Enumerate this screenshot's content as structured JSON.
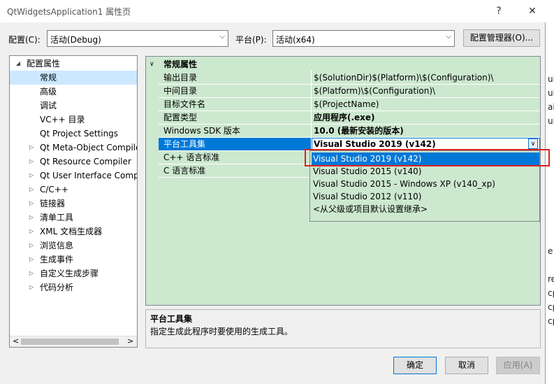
{
  "window": {
    "title": "QtWidgetsApplication1 属性页",
    "help_button": "?",
    "close_button": "✕"
  },
  "config": {
    "label": "配置(C):",
    "value": "活动(Debug)",
    "platform_label": "平台(P):",
    "platform_value": "活动(x64)",
    "manager_button": "配置管理器(O)..."
  },
  "tree": {
    "root": "配置属性",
    "items": [
      {
        "label": "常规",
        "expandable": false,
        "selected": true
      },
      {
        "label": "高级",
        "expandable": false
      },
      {
        "label": "调试",
        "expandable": false
      },
      {
        "label": "VC++ 目录",
        "expandable": false
      },
      {
        "label": "Qt Project Settings",
        "expandable": false
      },
      {
        "label": "Qt Meta-Object Compile",
        "expandable": true
      },
      {
        "label": "Qt Resource Compiler",
        "expandable": true
      },
      {
        "label": "Qt User Interface Comp",
        "expandable": true
      },
      {
        "label": "C/C++",
        "expandable": true
      },
      {
        "label": "链接器",
        "expandable": true
      },
      {
        "label": "清单工具",
        "expandable": true
      },
      {
        "label": "XML 文档生成器",
        "expandable": true
      },
      {
        "label": "浏览信息",
        "expandable": true
      },
      {
        "label": "生成事件",
        "expandable": true
      },
      {
        "label": "自定义生成步骤",
        "expandable": true
      },
      {
        "label": "代码分析",
        "expandable": true
      }
    ],
    "scroll_left": "<",
    "scroll_right": ">"
  },
  "grid": {
    "section": "常规属性",
    "rows": [
      {
        "name": "输出目录",
        "value": "$(SolutionDir)$(Platform)\\$(Configuration)\\",
        "bold": false
      },
      {
        "name": "中间目录",
        "value": "$(Platform)\\$(Configuration)\\",
        "bold": false
      },
      {
        "name": "目标文件名",
        "value": "$(ProjectName)",
        "bold": false
      },
      {
        "name": "配置类型",
        "value": "应用程序(.exe)",
        "bold": true
      },
      {
        "name": "Windows SDK 版本",
        "value": "10.0 (最新安装的版本)",
        "bold": true
      },
      {
        "name": "平台工具集",
        "value": "Visual Studio 2019 (v142)",
        "bold": true,
        "selected": true
      },
      {
        "name": "C++ 语言标准",
        "value": "",
        "bold": false
      },
      {
        "name": "C 语言标准",
        "value": "",
        "bold": false
      }
    ]
  },
  "dropdown": {
    "options": [
      {
        "label": "Visual Studio 2019 (v142)",
        "selected": true
      },
      {
        "label": "Visual Studio 2015 (v140)"
      },
      {
        "label": "Visual Studio 2015 - Windows XP (v140_xp)"
      },
      {
        "label": "Visual Studio 2012 (v110)"
      },
      {
        "label": "<从父级或项目默认设置继承>"
      }
    ]
  },
  "description": {
    "title": "平台工具集",
    "text": "指定生成此程序时要使用的生成工具。"
  },
  "buttons": {
    "ok": "确定",
    "cancel": "取消",
    "apply": "应用(A)"
  },
  "background_fragments": [
    "ui",
    "ui",
    "ai",
    "ui",
    "e",
    "re",
    "cp",
    "cp",
    "cp"
  ],
  "colors": {
    "grid_bg": "#cce8cf",
    "selection_blue": "#0078d7",
    "tree_selection": "#cce8ff",
    "highlight_red": "#e02020"
  }
}
